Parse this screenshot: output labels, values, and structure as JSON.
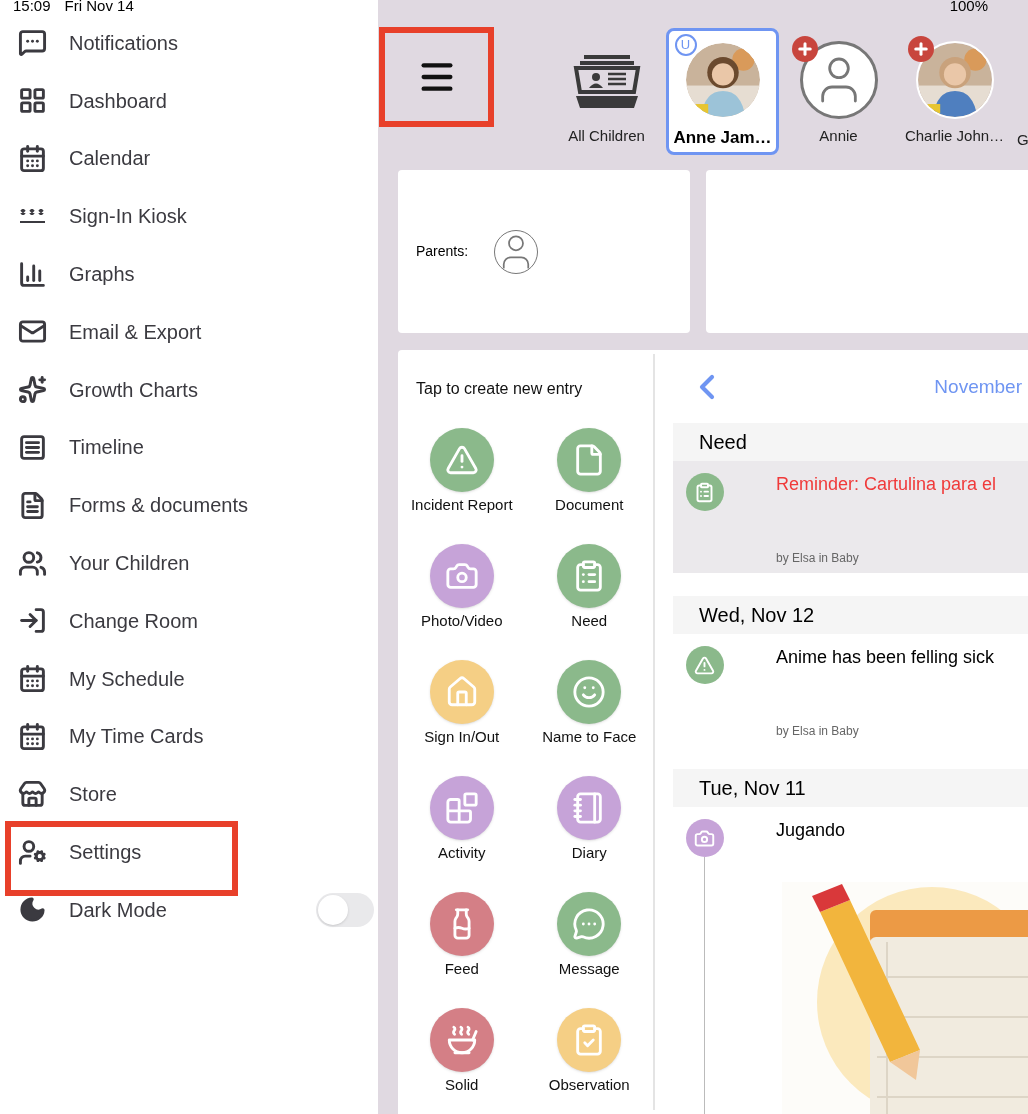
{
  "status_bar": {
    "time": "15:09",
    "date": "Fri Nov 14",
    "battery": "100%"
  },
  "sidebar": {
    "items": [
      {
        "label": "Notifications",
        "highlighted": false
      },
      {
        "label": "Dashboard",
        "highlighted": false
      },
      {
        "label": "Calendar",
        "highlighted": false
      },
      {
        "label": "Sign-In Kiosk",
        "highlighted": false
      },
      {
        "label": "Graphs",
        "highlighted": false
      },
      {
        "label": "Email & Export",
        "highlighted": false
      },
      {
        "label": "Growth Charts",
        "highlighted": false
      },
      {
        "label": "Timeline",
        "highlighted": false
      },
      {
        "label": "Forms & documents",
        "highlighted": false
      },
      {
        "label": "Your Children",
        "highlighted": false
      },
      {
        "label": "Change Room",
        "highlighted": false
      },
      {
        "label": "My Schedule",
        "highlighted": false
      },
      {
        "label": "My Time Cards",
        "highlighted": false
      },
      {
        "label": "Store",
        "highlighted": false
      },
      {
        "label": "Settings",
        "highlighted": true
      }
    ],
    "dark_mode": {
      "label": "Dark Mode",
      "on": false
    }
  },
  "menu_button": {
    "highlighted": true
  },
  "children": [
    {
      "kind": "all",
      "name": "All Children",
      "selected": false
    },
    {
      "name": "Anne Jam…",
      "selected": true,
      "badge": {
        "kind": "letter",
        "text": "U"
      }
    },
    {
      "kind": "placeholder",
      "name": "Annie",
      "selected": false,
      "badge": {
        "kind": "plus"
      }
    },
    {
      "name": "Charlie John…",
      "selected": false,
      "badge": {
        "kind": "plus"
      }
    },
    {
      "kind": "cut",
      "name": "G",
      "selected": false
    }
  ],
  "parents_card": {
    "label": "Parents:"
  },
  "new_entry": {
    "title": "Tap to create new entry",
    "items": [
      {
        "label": "Incident Report",
        "color": "#8bb98b"
      },
      {
        "label": "Document",
        "color": "#8bb98b"
      },
      {
        "label": "Photo/Video",
        "color": "#c6a3d8"
      },
      {
        "label": "Need",
        "color": "#8bb98b"
      },
      {
        "label": "Sign In/Out",
        "color": "#f5cf85"
      },
      {
        "label": "Name to Face",
        "color": "#8bb98b"
      },
      {
        "label": "Activity",
        "color": "#c6a3d8"
      },
      {
        "label": "Diary",
        "color": "#c6a3d8"
      },
      {
        "label": "Feed",
        "color": "#d47f86"
      },
      {
        "label": "Message",
        "color": "#8bb98b"
      },
      {
        "label": "Solid",
        "color": "#d47f86"
      },
      {
        "label": "Observation",
        "color": "#f5cf85"
      }
    ]
  },
  "timeline": {
    "month": "November",
    "sections": [
      {
        "header": "Need",
        "entries": [
          {
            "kind": "need",
            "title": "Reminder: Cartulina para el",
            "reminder": true,
            "selected": true,
            "byline": "by Elsa in Baby"
          }
        ]
      },
      {
        "header": "Wed, Nov 12",
        "entries": [
          {
            "kind": "incident",
            "title": "Anime has been felling sick",
            "reminder": false,
            "selected": false,
            "byline": "by Elsa in Baby"
          }
        ]
      },
      {
        "header": "Tue, Nov 11",
        "entries": [
          {
            "title": "Jugando",
            "reminder": false,
            "selected": false
          }
        ]
      }
    ]
  }
}
